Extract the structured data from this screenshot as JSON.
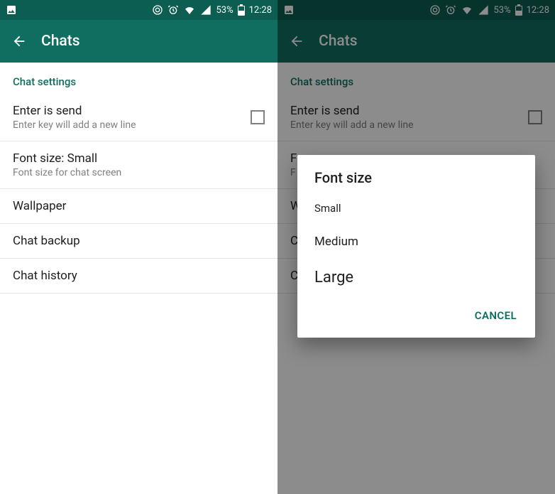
{
  "statusbar": {
    "battery_pct": "53%",
    "time": "12:28"
  },
  "appbar": {
    "title": "Chats"
  },
  "left": {
    "section_header": "Chat settings",
    "rows": {
      "enter_send": {
        "title": "Enter is send",
        "subtitle": "Enter key will add a new line",
        "checked": false
      },
      "font_size": {
        "title": "Font size: Small",
        "subtitle": "Font size for chat screen"
      },
      "wallpaper": {
        "title": "Wallpaper"
      },
      "chat_backup": {
        "title": "Chat backup"
      },
      "chat_history": {
        "title": "Chat history"
      }
    }
  },
  "right": {
    "section_header": "Chat settings",
    "rows": {
      "enter_send": {
        "title": "Enter is send",
        "subtitle": "Enter key will add a new line",
        "checked": false
      },
      "font_size_initial": "F",
      "wallpaper_initial": "W",
      "chat_backup_initial": "C",
      "chat_history_initial": "C"
    },
    "dialog": {
      "title": "Font size",
      "options": {
        "small": "Small",
        "medium": "Medium",
        "large": "Large"
      },
      "cancel": "CANCEL"
    }
  },
  "icons": {
    "image": "image-icon",
    "circled": "circled-icon",
    "alarm": "alarm-icon",
    "wifi": "wifi-icon",
    "signal": "signal-icon",
    "battery": "battery-icon",
    "back": "back-arrow-icon"
  },
  "colors": {
    "primary": "#0f6e60",
    "primary_dark": "#0b5e51",
    "text": "#202020",
    "text_secondary": "#808080"
  }
}
